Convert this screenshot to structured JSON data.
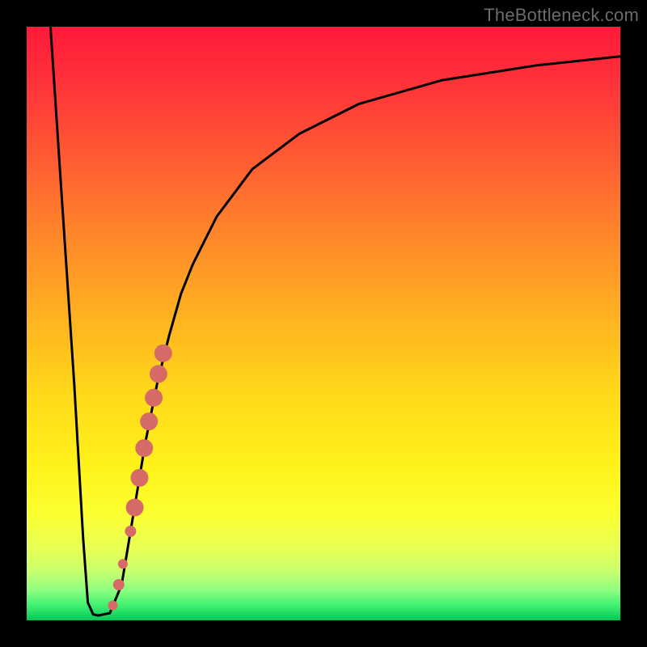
{
  "watermark": "TheBottleneck.com",
  "chart_data": {
    "type": "line",
    "title": "",
    "xlabel": "",
    "ylabel": "",
    "xlim": [
      0,
      100
    ],
    "ylim": [
      0,
      100
    ],
    "series": [
      {
        "name": "bottleneck-curve",
        "x": [
          4,
          6,
          8,
          9.5,
          10.3,
          11.2,
          12,
          14,
          16,
          18,
          20,
          22,
          24,
          26,
          28,
          32,
          38,
          46,
          56,
          70,
          86,
          100
        ],
        "y": [
          100,
          70,
          40,
          14,
          3,
          1,
          0.8,
          1.2,
          6,
          18,
          30,
          40,
          48,
          55,
          60,
          68,
          76,
          82,
          87,
          91,
          93.5,
          95
        ]
      }
    ],
    "highlight_segment": {
      "name": "bottleneck-range",
      "color": "#d66a66",
      "points": [
        {
          "x": 14.5,
          "y": 2.5,
          "r": 6
        },
        {
          "x": 15.5,
          "y": 6.0,
          "r": 7
        },
        {
          "x": 16.2,
          "y": 9.5,
          "r": 6
        },
        {
          "x": 17.5,
          "y": 15.0,
          "r": 7
        },
        {
          "x": 18.2,
          "y": 19.0,
          "r": 11
        },
        {
          "x": 19.0,
          "y": 24.0,
          "r": 11
        },
        {
          "x": 19.8,
          "y": 29.0,
          "r": 11
        },
        {
          "x": 20.6,
          "y": 33.5,
          "r": 11
        },
        {
          "x": 21.4,
          "y": 37.5,
          "r": 11
        },
        {
          "x": 22.2,
          "y": 41.5,
          "r": 11
        },
        {
          "x": 23.0,
          "y": 45.0,
          "r": 11
        }
      ]
    }
  }
}
